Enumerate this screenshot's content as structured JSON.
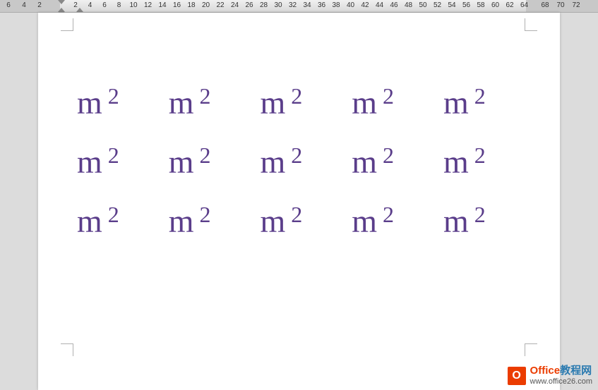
{
  "ruler": {
    "left_numbers": [
      6,
      4,
      2
    ],
    "main_numbers": [
      2,
      4,
      6,
      8,
      10,
      12,
      14,
      16,
      18,
      20,
      22,
      24,
      26,
      28,
      30,
      32,
      34,
      36,
      38,
      40,
      42,
      44,
      46,
      48,
      50,
      52,
      54,
      56,
      58,
      60,
      62,
      64
    ],
    "right_numbers": [
      68,
      70,
      72
    ]
  },
  "document": {
    "rows": [
      [
        {
          "base": "m",
          "sup": "2"
        },
        {
          "base": "m",
          "sup": "2"
        },
        {
          "base": "m",
          "sup": "2"
        },
        {
          "base": "m",
          "sup": "2"
        },
        {
          "base": "m",
          "sup": "2"
        }
      ],
      [
        {
          "base": "m",
          "sup": "2"
        },
        {
          "base": "m",
          "sup": "2"
        },
        {
          "base": "m",
          "sup": "2"
        },
        {
          "base": "m",
          "sup": "2"
        },
        {
          "base": "m",
          "sup": "2"
        }
      ],
      [
        {
          "base": "m",
          "sup": "2"
        },
        {
          "base": "m",
          "sup": "2"
        },
        {
          "base": "m",
          "sup": "2"
        },
        {
          "base": "m",
          "sup": "2"
        },
        {
          "base": "m",
          "sup": "2"
        }
      ]
    ],
    "text_color": "#5a3d8a"
  },
  "watermark": {
    "logo_letter": "O",
    "title_part1": "Office",
    "title_part2": "教程网",
    "url": "www.office26.com"
  }
}
